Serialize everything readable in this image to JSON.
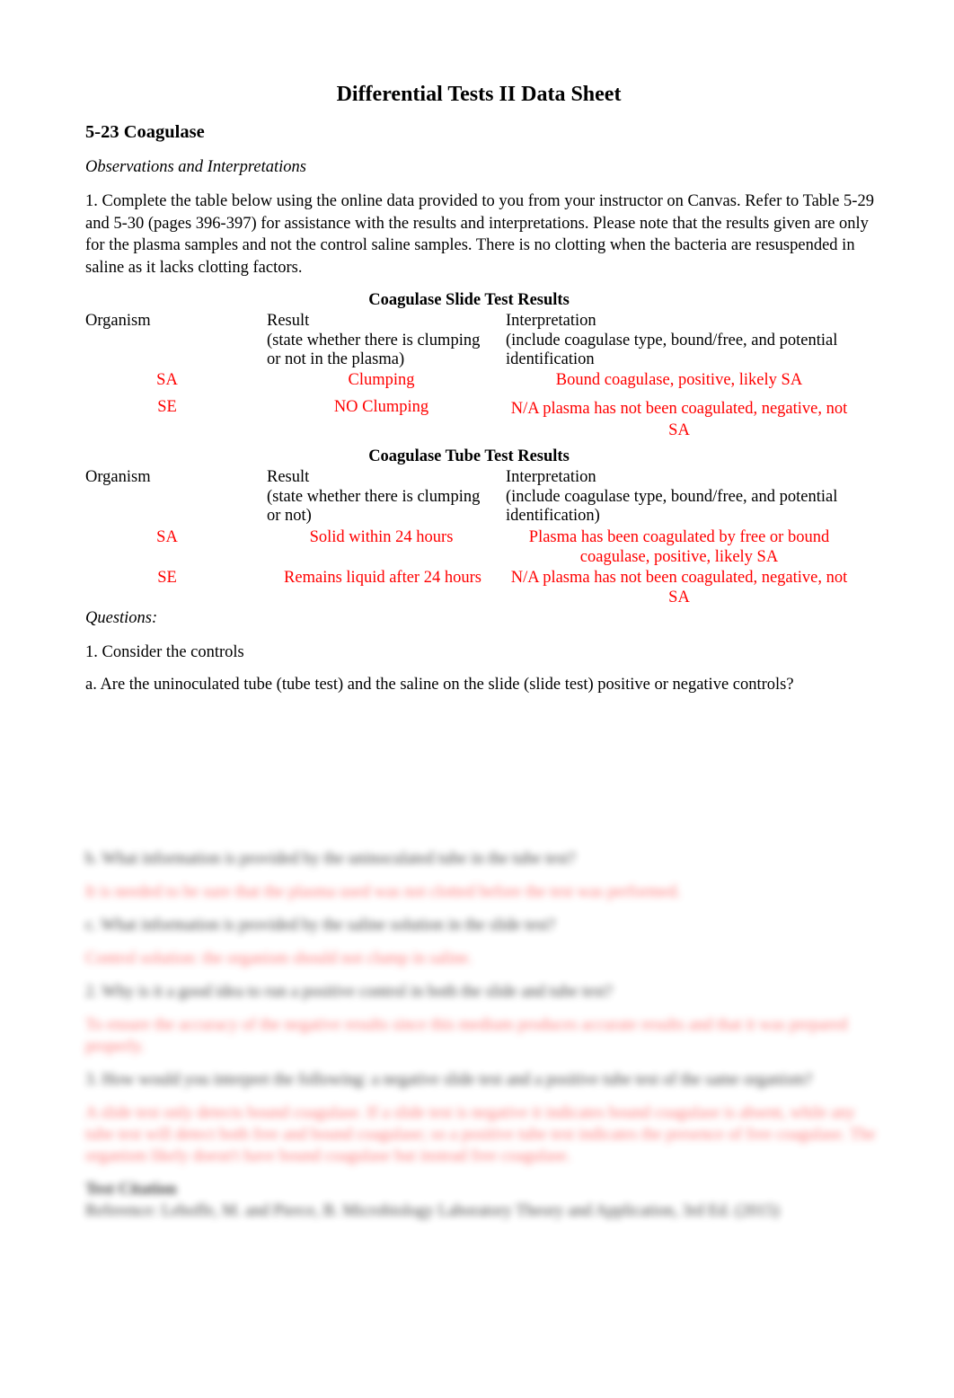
{
  "document": {
    "title": "Differential Tests II Data Sheet",
    "section_heading": "5-23 Coagulase",
    "subheading": "Observations and Interpretations",
    "instructions": "1. Complete the table below using the online data provided to you from your instructor on Canvas. Refer to Table 5-29 and 5-30 (pages 396-397) for assistance with the results and interpretations. Please note that the results given are only for the plasma samples and not the control saline samples. There is no clotting when the bacteria are resuspended in saline as it lacks clotting factors."
  },
  "slide_table": {
    "title": "Coagulase Slide Test Results",
    "headers": {
      "organism": "Organism",
      "result": "Result",
      "result_note": "(state whether there is clumping or not in the plasma)",
      "interpretation": "Interpretation",
      "interpretation_note": "(include coagulase type, bound/free, and potential identification"
    },
    "rows": [
      {
        "organism": "SA",
        "result": "Clumping",
        "interpretation": "Bound coagulase, positive, likely SA"
      },
      {
        "organism": "SE",
        "result": "NO Clumping",
        "interpretation": "N/A plasma has not been coagulated, negative, not SA"
      }
    ]
  },
  "tube_table": {
    "title": "Coagulase Tube Test Results",
    "headers": {
      "organism": "Organism",
      "result": "Result",
      "result_note": "(state whether there is clumping or not)",
      "interpretation": "Interpretation",
      "interpretation_note": "(include coagulase type, bound/free, and potential identification)"
    },
    "rows": [
      {
        "organism": "SA",
        "result": "Solid within 24 hours",
        "interpretation": "Plasma has been coagulated by free or bound coagulase, positive, likely SA"
      },
      {
        "organism": "SE",
        "result": "Remains liquid after 24 hours",
        "interpretation": "N/A plasma has not been coagulated, negative, not SA"
      }
    ]
  },
  "questions": {
    "heading": "Questions:",
    "q1": "1. Consider the controls",
    "q1a": "a. Are the uninoculated tube (tube test) and the saline on the slide (slide test) positive or negative controls?"
  },
  "obscured": {
    "lines": [
      {
        "text": "b. What information is provided by the uninoculated tube in the tube test?",
        "answer": false
      },
      {
        "text": "It is needed to be sure that the plasma used was not clotted before the test was performed.",
        "answer": true
      },
      {
        "text": "c. What information is provided by the saline solution in the slide test?",
        "answer": false
      },
      {
        "text": "Control solution: the organism should not clump in saline.",
        "answer": true
      },
      {
        "text": "2. Why is it a good idea to run a positive control in both the slide and tube test?",
        "answer": false
      },
      {
        "text": "To ensure the accuracy of the negative results since this medium produces accurate results and that it was prepared properly.",
        "answer": true
      },
      {
        "text": "3. How would you interpret the following: a negative slide test and a positive tube test of the same organism?",
        "answer": false
      },
      {
        "text": "A slide test only detects bound coagulase. If a slide test is negative it indicates bound coagulase is absent, while any tube test will detect both free and bound coagulase; so a positive tube test indicates the presence of free coagulase. The organism likely doesn't have bound coagulase but instead free coagulase.",
        "answer": true
      },
      {
        "text": "Test Citation",
        "answer": false
      },
      {
        "text": "Reference: Leboffe, M. and Pierce, B. Microbiology Laboratory Theory and Application, 3rd Ed. (2015)",
        "answer": false
      }
    ]
  }
}
